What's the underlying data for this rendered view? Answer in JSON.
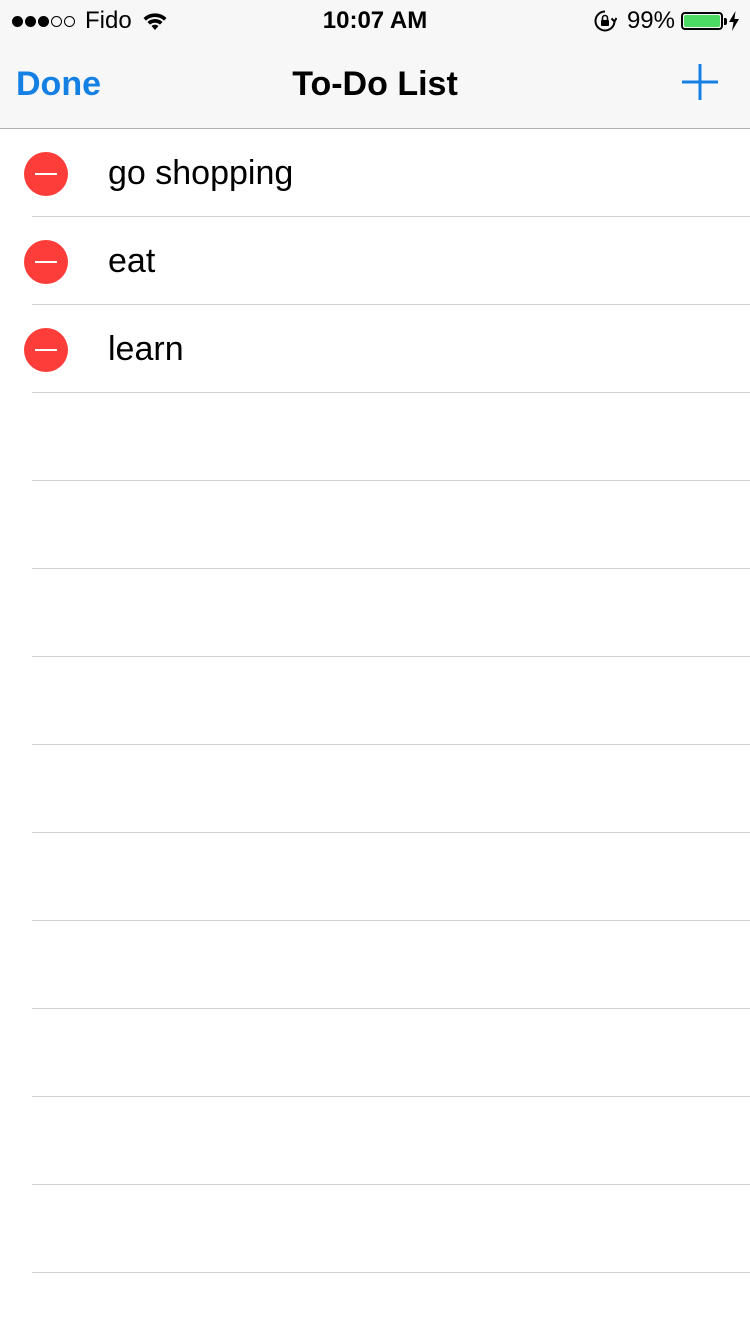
{
  "status_bar": {
    "carrier": "Fido",
    "time": "10:07 AM",
    "battery_percent_label": "99%",
    "battery_level": 0.99,
    "signal_bars_filled": 3,
    "signal_bars_total": 5,
    "icons": [
      "wifi-icon",
      "orientation-lock-icon",
      "battery-icon",
      "charging-bolt-icon"
    ]
  },
  "nav": {
    "left_button": "Done",
    "title": "To-Do List",
    "right_icon": "plus-icon"
  },
  "list": {
    "items": [
      {
        "label": "go shopping",
        "icon": "delete-minus-icon"
      },
      {
        "label": "eat",
        "icon": "delete-minus-icon"
      },
      {
        "label": "learn",
        "icon": "delete-minus-icon"
      }
    ],
    "empty_rows": 10
  },
  "colors": {
    "accent": "#1580e4",
    "delete": "#fc3d39",
    "battery": "#4cd964"
  }
}
